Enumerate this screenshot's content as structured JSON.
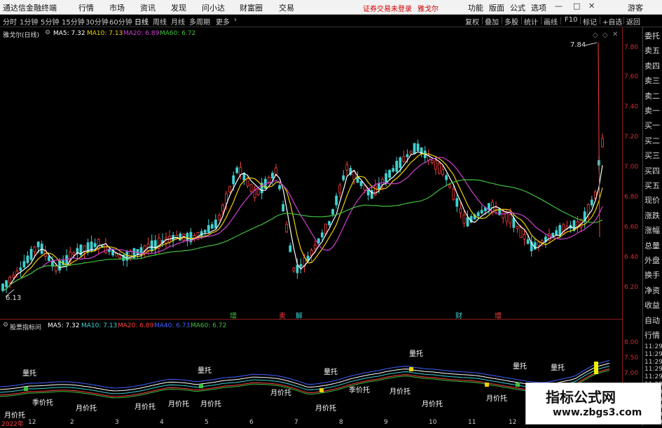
{
  "menubar": {
    "app_title": "通达信金融终端",
    "items": [
      "行情",
      "市场",
      "资讯",
      "发现",
      "问小达",
      "财富圈",
      "交易"
    ],
    "login_notice": "证券交易未登录",
    "stock_name": "雅戈尔",
    "right_items": [
      "功能",
      "版面",
      "公式",
      "选项",
      "游客"
    ]
  },
  "periodbar": {
    "periods": [
      "分时",
      "1分钟",
      "5分钟",
      "15分钟",
      "30分钟",
      "60分钟",
      "日线",
      "周线",
      "月线",
      "多周期",
      "更多"
    ],
    "active": "日线",
    "right_items": [
      "复权",
      "叠加",
      "多股",
      "统计",
      "画线",
      "F10",
      "标记",
      "+自选",
      "返回"
    ]
  },
  "main_legend": {
    "title": "雅戈尔(日线)",
    "ma5": "MA5: 7.32",
    "ma10": "MA10: 7.13",
    "ma20": "MA20: 6.89",
    "ma60": "MA60: 6.72"
  },
  "main_annotations": {
    "high": "7.84",
    "low": "6.13"
  },
  "price_axis": [
    "7.80",
    "7.60",
    "7.40",
    "7.20",
    "7.00",
    "6.80",
    "6.60",
    "6.40",
    "6.20"
  ],
  "event_markers": [
    "增",
    "卖",
    "解",
    "财",
    "增"
  ],
  "sub_legend": {
    "title": "股票指标问",
    "ma5": "MA5: 7.32",
    "ma10": "MA10: 7.13",
    "ma20": "MA20: 6.89",
    "ma40": "MA40: 6.73",
    "ma60": "MA60: 6.72"
  },
  "sub_axis": [
    "8.00",
    "7.50",
    "7.00"
  ],
  "sub_labels": [
    "量托",
    "季价托",
    "月价托",
    "量托",
    "月价托",
    "月价托",
    "月价托",
    "月价托",
    "量托",
    "月价托",
    "季价托",
    "月价托",
    "量托",
    "月价托",
    "月价托",
    "量托",
    "量托",
    "月价托"
  ],
  "right_strip": [
    "委托",
    "卖五",
    "卖四",
    "卖三",
    "卖二",
    "卖一",
    "买一",
    "买二",
    "买三",
    "买四",
    "买五",
    "现价",
    "涨跌",
    "涨幅",
    "总量",
    "外盘",
    "换手",
    "净资",
    "收益",
    "自动",
    "行情",
    "11:29",
    "11:29",
    "11:29",
    "11:29",
    "11:29",
    "11:29",
    "11:29",
    "11:29",
    "11:29",
    "11:29",
    "11:29"
  ],
  "time_axis": [
    "2022年",
    "12",
    "2",
    "3",
    "4",
    "5",
    "6",
    "7",
    "8",
    "9",
    "10",
    "11",
    "12"
  ],
  "watermark": {
    "line1": "指标公式网",
    "line2": "www.zbgs3.com"
  },
  "colors": {
    "ma5": "#ffffff",
    "ma10": "#f0d000",
    "ma20": "#d040d0",
    "ma60": "#40c040",
    "up": "#ff4040",
    "down": "#40d0d0",
    "axis": "#d03030"
  }
}
